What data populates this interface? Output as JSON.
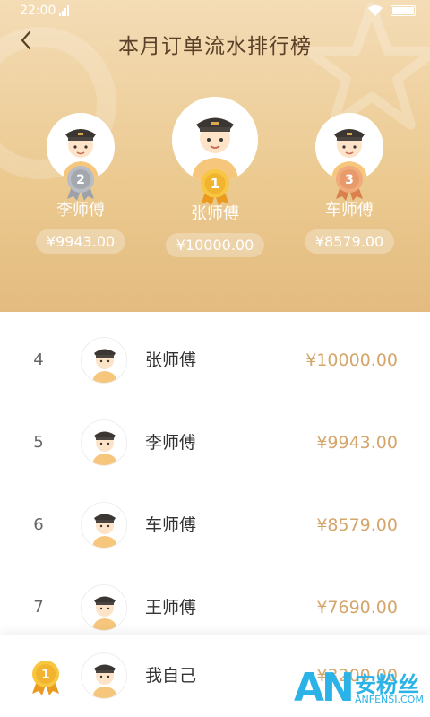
{
  "status_bar": {
    "time": "22:00"
  },
  "header": {
    "title": "本月订单流水排行榜"
  },
  "podium": [
    {
      "place": "2",
      "name": "李师傅",
      "amount": "¥9943.00"
    },
    {
      "place": "1",
      "name": "张师傅",
      "amount": "¥10000.00"
    },
    {
      "place": "3",
      "name": "车师傅",
      "amount": "¥8579.00"
    }
  ],
  "list": [
    {
      "rank": "4",
      "name": "张师傅",
      "amount": "¥10000.00"
    },
    {
      "rank": "5",
      "name": "李师傅",
      "amount": "¥9943.00"
    },
    {
      "rank": "6",
      "name": "车师傅",
      "amount": "¥8579.00"
    },
    {
      "rank": "7",
      "name": "王师傅",
      "amount": "¥7690.00"
    }
  ],
  "self": {
    "medal": "1",
    "name": "我自己",
    "amount": "¥3200.00"
  },
  "watermark": {
    "logo": "AN",
    "text_cn": "安粉丝",
    "text_en": "ANFENSI.COM"
  },
  "colors": {
    "header_gold": "#ebc98f",
    "amount_gold": "#d4a66b",
    "medal_gold": "#f2b42f",
    "medal_silver": "#b9bcc2",
    "medal_bronze": "#e89a6a",
    "watermark_blue": "#2bb3e8"
  },
  "icons": {
    "back": "chevron-left-icon",
    "signal": "signal-icon",
    "wifi": "wifi-icon",
    "battery": "battery-icon",
    "medal": "medal-icon",
    "avatar": "driver-avatar"
  }
}
